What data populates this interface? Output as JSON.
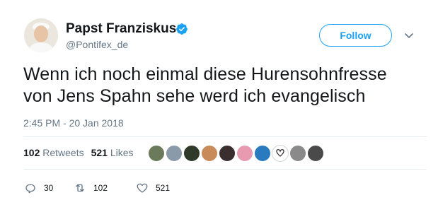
{
  "user": {
    "display_name": "Papst Franziskus",
    "handle": "@Pontifex_de",
    "verified": true
  },
  "follow_button": {
    "label": "Follow"
  },
  "tweet": {
    "text_line1": "Wenn ich noch einmal diese Hurensohnfresse",
    "text_line2": "von Jens Spahn sehe werd ich evangelisch",
    "timestamp": "2:45 PM - 20 Jan 2018"
  },
  "stats": {
    "retweets_count": "102",
    "retweets_label": "Retweets",
    "likes_count": "521",
    "likes_label": "Likes"
  },
  "liker_avatars": [
    {
      "color": "#6b7a5a"
    },
    {
      "color": "#8a9aa8"
    },
    {
      "color": "#2f3a2a"
    },
    {
      "color": "#c98a5a"
    },
    {
      "color": "#3a2e2e"
    },
    {
      "color": "#e89ab0"
    },
    {
      "color": "#2a7ac0"
    },
    {
      "color": "#ffffff"
    },
    {
      "color": "#8a8a8a"
    },
    {
      "color": "#4a4a4a"
    }
  ],
  "actions": {
    "reply_count": "30",
    "retweet_count": "102",
    "like_count": "521"
  },
  "colors": {
    "accent": "#1da1f2",
    "text": "#14171a",
    "secondary": "#657786"
  }
}
